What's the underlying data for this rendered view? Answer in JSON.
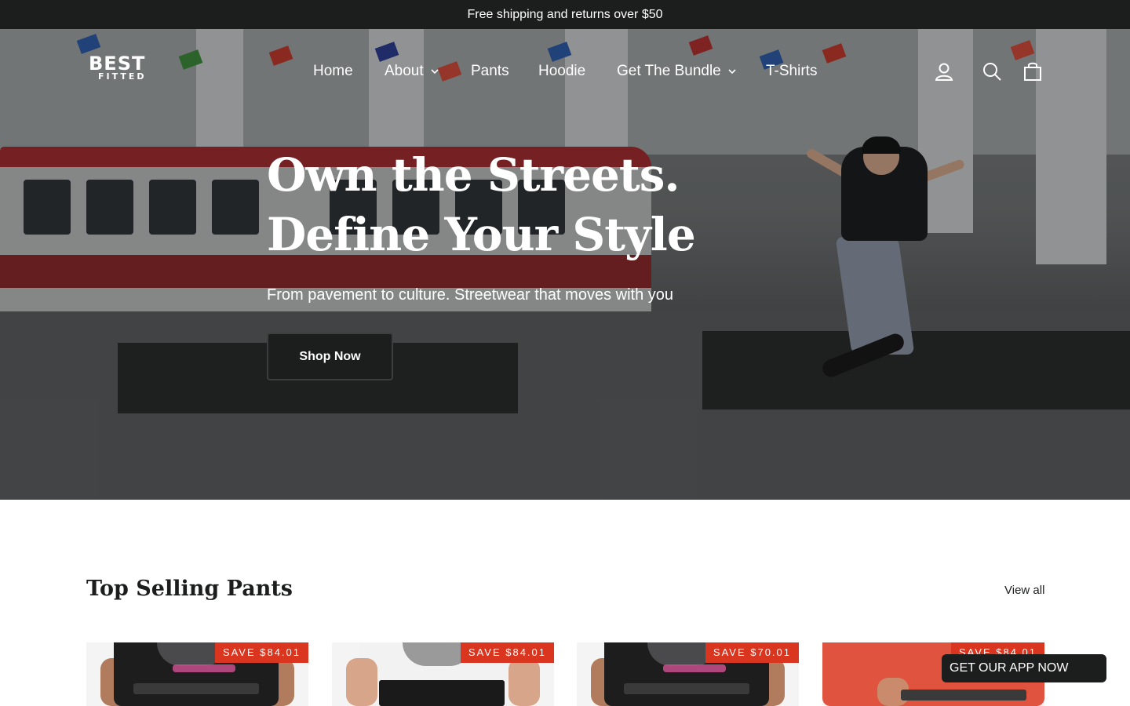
{
  "announcement": "Free shipping and returns over $50",
  "logo": {
    "line1": "BEST",
    "line2": "FITTED"
  },
  "nav": {
    "items": [
      {
        "label": "Home",
        "has_dropdown": false
      },
      {
        "label": "About",
        "has_dropdown": true
      },
      {
        "label": "Pants",
        "has_dropdown": false
      },
      {
        "label": "Hoodie",
        "has_dropdown": false
      },
      {
        "label": "Get The Bundle",
        "has_dropdown": true
      },
      {
        "label": "T-Shirts",
        "has_dropdown": false
      }
    ]
  },
  "header_icons": [
    "account-icon",
    "search-icon",
    "cart-icon"
  ],
  "hero": {
    "title": "Own the Streets. Define Your Style",
    "subtitle": "From pavement to culture. Streetwear that moves with you",
    "button": "Shop Now"
  },
  "section": {
    "title": "Top Selling Pants",
    "view_all": "View all"
  },
  "products": [
    {
      "badge": "SAVE $84.01"
    },
    {
      "badge": "SAVE $84.01"
    },
    {
      "badge": "SAVE $70.01"
    },
    {
      "badge": "SAVE $84.01"
    }
  ],
  "app_banner": "GET OUR APP NOW",
  "colors": {
    "announcement_bg": "#1c1d1d",
    "badge_bg": "#d9351f",
    "button_bg": "#1c1d1d"
  }
}
